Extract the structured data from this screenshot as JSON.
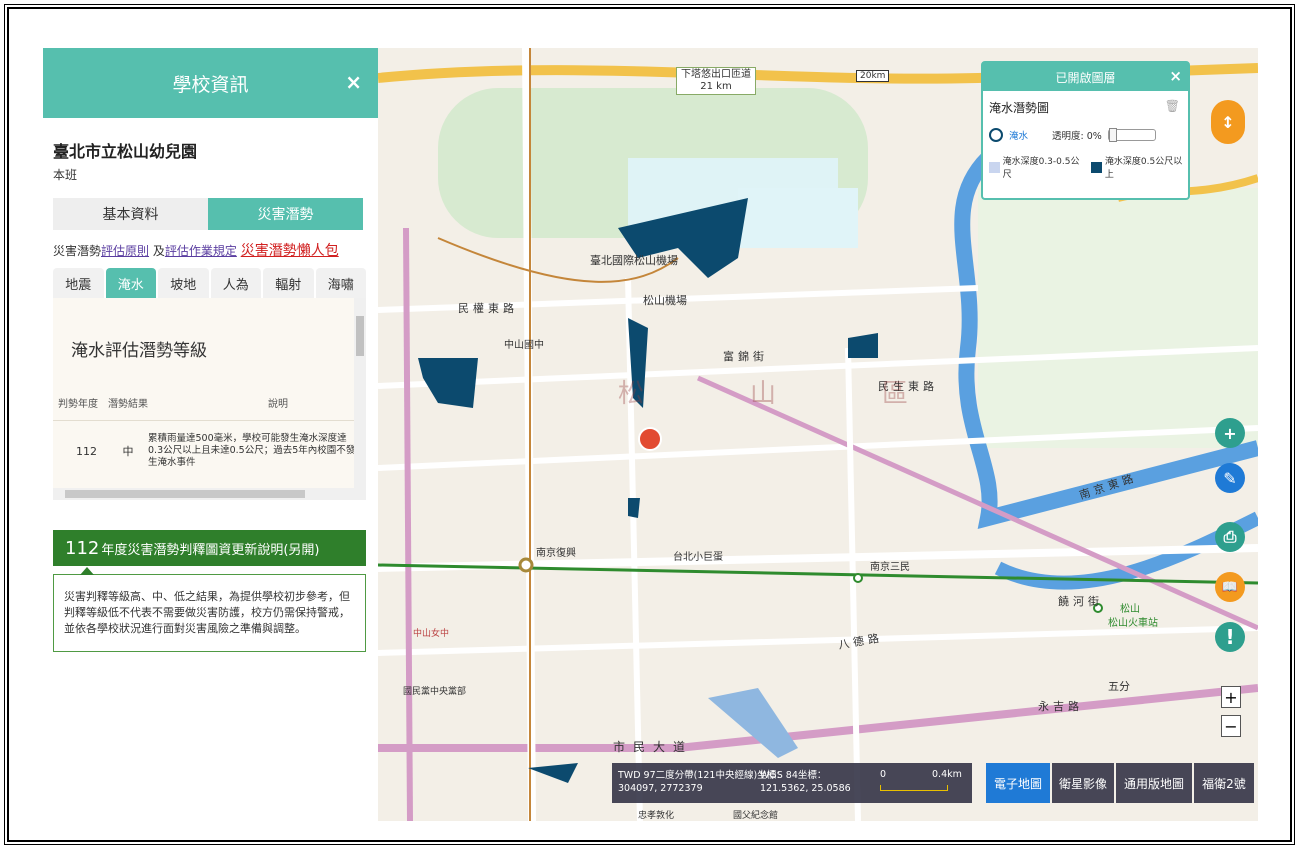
{
  "panel": {
    "title": "學校資訊",
    "close": "×",
    "school_name": "臺北市立松山幼兒園",
    "school_class": "本班",
    "tabs": [
      "基本資料",
      "災害潛勢"
    ],
    "links_prefix": "災害潛勢",
    "link1": "評估原則",
    "links_mid": " 及",
    "link2": "評估作業規定",
    "link3": "災害潛勢懶人包",
    "hazard_tabs": [
      "地震",
      "淹水",
      "坡地",
      "人為",
      "輻射",
      "海嘯"
    ],
    "hazard_title": "淹水評估潛勢等級",
    "table_headers": [
      "判勢年度",
      "潛勢結果",
      "說明"
    ],
    "table_row": {
      "year": "112",
      "result": "中",
      "desc": "累積雨量達500毫米，學校可能發生淹水深度達0.3公尺以上且未達0.5公尺；過去5年內校園不發生淹水事件"
    },
    "update_year": "112",
    "update_text": "年度災害潛勢判釋圖資更新說明(另開)",
    "note": "災害判釋等級高、中、低之結果，為提供學校初步參考，但判釋等級低不代表不需要做災害防護，校方仍需保持警戒，並依各學校狀況進行面對災害風險之準備與調整。"
  },
  "layers": {
    "title": "已開啟圖層",
    "close": "×",
    "layer_name": "淹水潛勢圖",
    "trash_icon": "🗑",
    "layer_label": "淹水",
    "opacity_label": "透明度: 0%",
    "opacity_value": 0,
    "legend1": "淹水深度0.3-0.5公尺",
    "legend2": "淹水深度0.5公尺以上",
    "legend1_color": "#c9d5ef",
    "legend2_color": "#0c4a6e"
  },
  "map_labels": {
    "highway_sign": "下塔悠出口匝道",
    "highway_km": "21 km",
    "km_sign": "20km",
    "airport": "臺北國際松山機場",
    "airport_station": "松山機場",
    "minquan": "民權東路",
    "minsheng": "民生東路",
    "fujin": "富錦街",
    "nanjing": "南京東路",
    "bade": "八德路",
    "civic": "市民大道",
    "district": "松　山　區",
    "nanjing_fuxing": "南京復興",
    "nanjing_sanmin": "南京三民",
    "taipei_arena": "台北小巨蛋",
    "zhongshan_school": "中山國中",
    "songshan": "松山",
    "songshan_station": "松山火車站",
    "yongji": "永吉路",
    "wufen": "五分",
    "guofu": "國父紀念館",
    "zhongxiao": "忠孝敦化",
    "kmt": "國民黨中央黨部",
    "zs_girls": "中山女中",
    "keelung_river": "饒河街"
  },
  "coord": {
    "twd_label": "TWD 97二度分帶(121中央經線)坐標：",
    "twd_value": "304097, 2772379",
    "wgs_label": "WGS 84坐標：",
    "wgs_value": "121.5362, 25.0586",
    "scale_0": "0",
    "scale_1": "0.4km"
  },
  "basemaps": [
    "電子地圖",
    "衛星影像",
    "通用版地圖",
    "福衛2號"
  ],
  "zoom": {
    "in": "+",
    "out": "−"
  },
  "tools": {
    "compass": "↕",
    "plus": "+",
    "pen": "✎",
    "print": "⎙",
    "book": "📖",
    "alert": "!"
  }
}
